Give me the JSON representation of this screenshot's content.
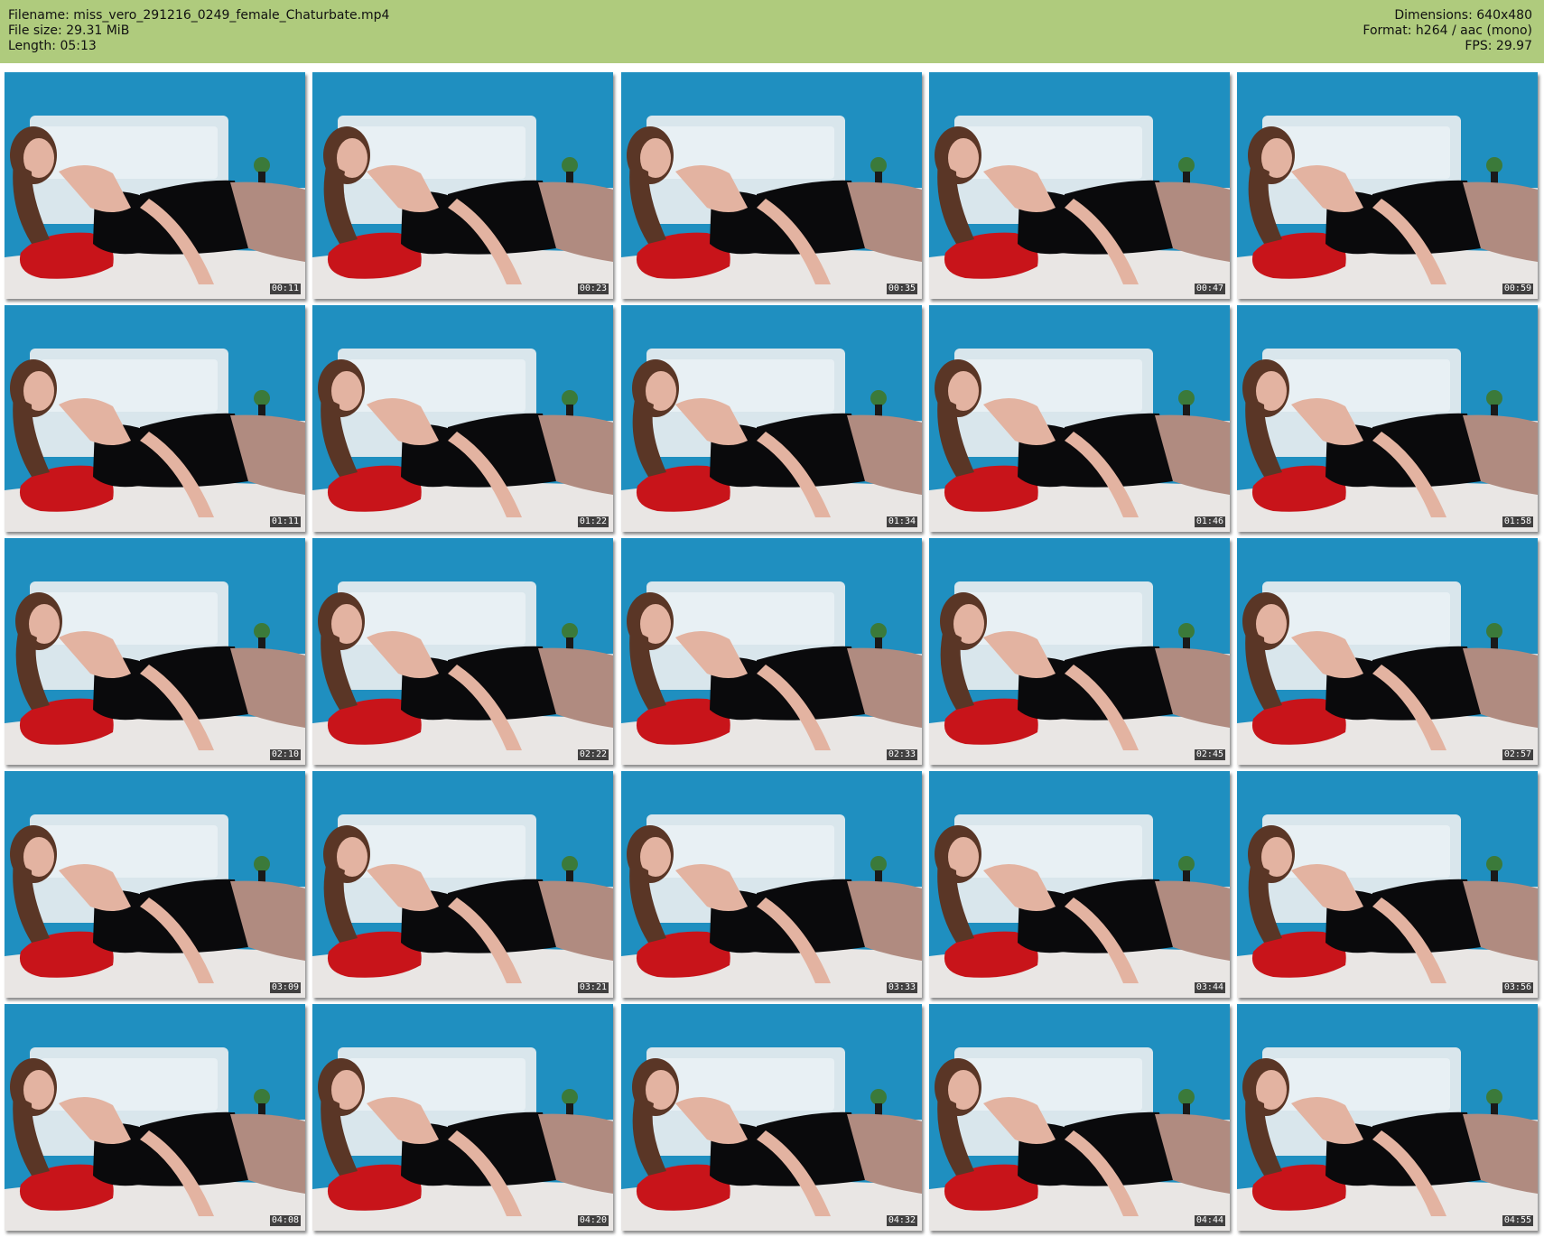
{
  "header": {
    "filename": "Filename: miss_vero_291216_0249_female_Chaturbate.mp4",
    "filesize": "File size: 29.31 MiB",
    "length": "Length: 05:13",
    "dimensions": "Dimensions: 640x480",
    "format": "Format: h264 / aac (mono)",
    "fps": "FPS: 29.97"
  },
  "thumbnails": [
    {
      "timestamp": "00:11"
    },
    {
      "timestamp": "00:23"
    },
    {
      "timestamp": "00:35"
    },
    {
      "timestamp": "00:47"
    },
    {
      "timestamp": "00:59"
    },
    {
      "timestamp": "01:11"
    },
    {
      "timestamp": "01:22"
    },
    {
      "timestamp": "01:34"
    },
    {
      "timestamp": "01:46"
    },
    {
      "timestamp": "01:58"
    },
    {
      "timestamp": "02:10"
    },
    {
      "timestamp": "02:22"
    },
    {
      "timestamp": "02:33"
    },
    {
      "timestamp": "02:45"
    },
    {
      "timestamp": "02:57"
    },
    {
      "timestamp": "03:09"
    },
    {
      "timestamp": "03:21"
    },
    {
      "timestamp": "03:33"
    },
    {
      "timestamp": "03:44"
    },
    {
      "timestamp": "03:56"
    },
    {
      "timestamp": "04:08"
    },
    {
      "timestamp": "04:20"
    },
    {
      "timestamp": "04:32"
    },
    {
      "timestamp": "04:44"
    },
    {
      "timestamp": "04:55"
    }
  ],
  "colors": {
    "header_bg": "#afcb7d",
    "wall": "#1f8fc0",
    "headboard": "#d9e6ec",
    "sheet": "#e9e6e4",
    "pillow": "#c8141a",
    "dress": "#0a0a0c",
    "skin": "#e3b3a1",
    "hair": "#5a3626"
  }
}
